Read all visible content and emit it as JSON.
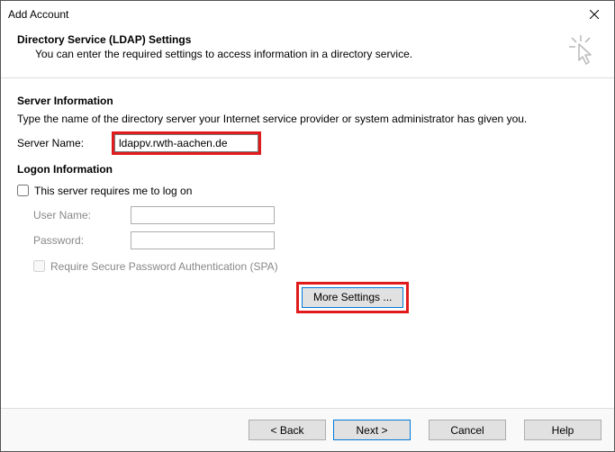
{
  "window": {
    "title": "Add Account"
  },
  "header": {
    "title": "Directory Service (LDAP) Settings",
    "description": "You can enter the required settings to access information in a directory service."
  },
  "server_info": {
    "section_title": "Server Information",
    "description": "Type the name of the directory server your Internet service provider or system administrator has given you.",
    "server_name_label": "Server Name:",
    "server_name_value": "ldappv.rwth-aachen.de"
  },
  "logon_info": {
    "section_title": "Logon Information",
    "require_logon_label": "This server requires me to log on",
    "require_logon_checked": false,
    "user_name_label": "User Name:",
    "user_name_value": "",
    "password_label": "Password:",
    "password_value": "",
    "spa_label": "Require Secure Password Authentication (SPA)",
    "spa_checked": false
  },
  "buttons": {
    "more_settings": "More Settings ...",
    "back": "< Back",
    "next": "Next >",
    "cancel": "Cancel",
    "help": "Help"
  }
}
